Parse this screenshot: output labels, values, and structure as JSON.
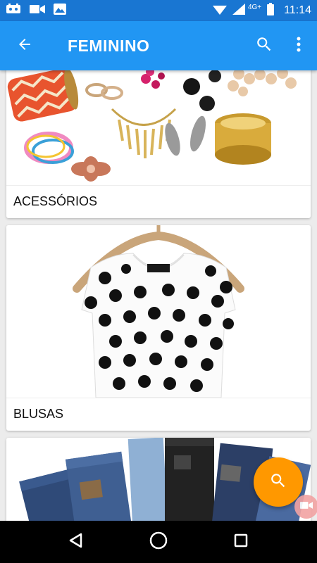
{
  "status_bar": {
    "icons": [
      "notification-icon",
      "video-camera-icon",
      "image-icon"
    ],
    "network": "4G+",
    "time": "11:14"
  },
  "app_bar": {
    "title": "FEMININO",
    "back_icon": "arrow-left-icon",
    "search_icon": "search-icon",
    "more_icon": "more-vertical-icon"
  },
  "categories": [
    {
      "label": "ACESSÓRIOS",
      "image": "accessories-jewelry"
    },
    {
      "label": "BLUSAS",
      "image": "polka-dot-blouse"
    },
    {
      "label": "",
      "image": "jeans-stack"
    }
  ],
  "fab": {
    "icon": "search-icon",
    "color": "#ff9800"
  },
  "mini_fab": {
    "icon": "video-camera-icon",
    "color": "#f2a3a3"
  },
  "colors": {
    "status_bar": "#1976d2",
    "app_bar": "#2196f3",
    "background": "#ececec"
  }
}
